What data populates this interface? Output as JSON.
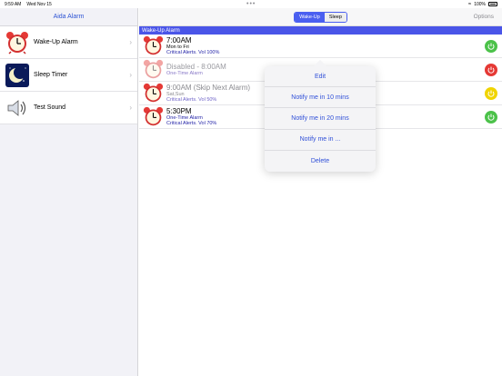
{
  "status_bar": {
    "time": "9:59 AM",
    "date": "Wed Nov 15",
    "battery": "100%"
  },
  "sidebar": {
    "title": "Aida Alarm",
    "items": [
      {
        "label": "Wake-Up Alarm",
        "icon": "alarm-clock-icon"
      },
      {
        "label": "Sleep Timer",
        "icon": "moon-icon"
      },
      {
        "label": "Test Sound",
        "icon": "speaker-icon"
      }
    ]
  },
  "main": {
    "segments": [
      "Wake-Up",
      "Sleep"
    ],
    "active_segment": "Wake-Up",
    "options_label": "Options",
    "section_title": "Wake-Up Alarm",
    "alarms": [
      {
        "time": "7:00AM",
        "days": "Mon to Fri",
        "detail": "Critical Alerts. Vol 100%",
        "state": "on",
        "button_color": "#4cc24a"
      },
      {
        "time": "Disabled - 8:00AM",
        "days": "",
        "detail": "One-Time Alarm",
        "state": "disabled",
        "button_color": "#e53935"
      },
      {
        "time": "9:00AM (Skip Next Alarm)",
        "days": "Sat,Sun",
        "detail": "Critical Alerts. Vol 50%",
        "state": "skip",
        "button_color": "#f0d400"
      },
      {
        "time": "5:30PM",
        "days": "One-Time Alarm",
        "detail": "Critical Alerts. Vol 70%",
        "state": "on",
        "button_color": "#4cc24a"
      }
    ]
  },
  "popover": {
    "items": [
      "Edit",
      "Notify me in 10 mins",
      "Notify me in 20 mins",
      "Notify me in ...",
      "Delete"
    ]
  },
  "colors": {
    "accent": "#4a55e8",
    "link": "#2f4fd8"
  }
}
